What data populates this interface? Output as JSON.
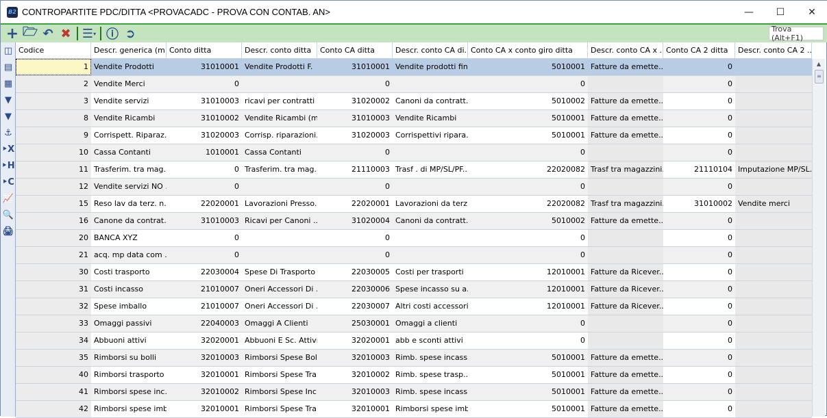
{
  "window": {
    "title": "CONTROPARTITE PDC/DITTA <PROVACADC - PROVA CON CONTAB. AN>",
    "app_icon": "B2"
  },
  "toolbar": {
    "find_label": "Trova (Alt+F1)"
  },
  "columns": [
    "Codice",
    "Descr. generica (m...",
    "Conto ditta",
    "Descr. conto ditta",
    "Conto CA ditta",
    "Descr. conto CA di...",
    "Conto CA x conto giro ditta",
    "Descr. conto CA x ...",
    "Conto CA 2 ditta",
    "Descr. conto CA 2 ..."
  ],
  "rows": [
    [
      "1",
      "Vendite Prodotti",
      "31010001",
      "Vendite Prodotti F.",
      "31010001",
      "Vendite prodotti finiti",
      "5010001",
      "Fatture da emette...",
      "0",
      ""
    ],
    [
      "2",
      "Vendite Merci",
      "0",
      "",
      "0",
      "",
      "0",
      "",
      "0",
      ""
    ],
    [
      "3",
      "Vendite servizi",
      "31010003",
      "ricavi per contratti ...",
      "31020002",
      "Canoni da contratt...",
      "5010002",
      "Fatture da emette...",
      "0",
      ""
    ],
    [
      "8",
      "Vendite Ricambi",
      "31010002",
      "Vendite Ricambi (m...",
      "31010003",
      "Vendite Ricambi",
      "5010001",
      "Fatture da emette...",
      "0",
      ""
    ],
    [
      "9",
      "Corrispett. Riparaz...",
      "31020003",
      "Corrisp. riparazioni...",
      "31020003",
      "Corrispettivi ripara...",
      "5010001",
      "Fatture da emette...",
      "0",
      ""
    ],
    [
      "10",
      "Cassa Contanti",
      "1010001",
      "Cassa Contanti",
      "0",
      "",
      "0",
      "",
      "0",
      ""
    ],
    [
      "11",
      "Trasferim. tra mag...",
      "0",
      "Trasferim. tra mag...",
      "21110003",
      "Trasf . di MP/SL/PF...",
      "22020082",
      "Trasf tra magazzini...",
      "21110104",
      "Imputazione MP/SL..."
    ],
    [
      "12",
      "Vendite servizi NO ...",
      "0",
      "",
      "0",
      "",
      "0",
      "",
      "0",
      ""
    ],
    [
      "15",
      "Reso lav da terz. n...",
      "22020001",
      "Lavorazioni Presso...",
      "22020001",
      "Lavorazioni da terz...",
      "22020082",
      "Trasf tra magazzini...",
      "31010002",
      "Vendite merci"
    ],
    [
      "16",
      "Canone da contrat...",
      "31010003",
      "Ricavi per Canoni  ...",
      "31020004",
      "Canoni da contratt...",
      "5010002",
      "Fatture da emette...",
      "0",
      ""
    ],
    [
      "20",
      "BANCA XYZ",
      "0",
      "",
      "0",
      "",
      "0",
      "",
      "0",
      ""
    ],
    [
      "21",
      "acq. mp data com ...",
      "0",
      "",
      "0",
      "",
      "0",
      "",
      "0",
      ""
    ],
    [
      "30",
      "Costi trasporto",
      "22030004",
      "Spese Di Trasporto",
      "22030005",
      "Costi per trasporti",
      "12010001",
      "Fatture da Ricever...",
      "0",
      ""
    ],
    [
      "31",
      "Costi incasso",
      "21010007",
      "Oneri Accessori Di ...",
      "22030006",
      "Spese incasso su a...",
      "12010001",
      "Fatture da Ricever...",
      "0",
      ""
    ],
    [
      "32",
      "Spese imballo",
      "21010007",
      "Oneri Accessori Di ...",
      "22030007",
      "Altri costi accessori...",
      "12010001",
      "Fatture da Ricever...",
      "0",
      ""
    ],
    [
      "33",
      "Omaggi passivi",
      "22040003",
      "Omaggi A Clienti",
      "25030001",
      "Omaggi a clienti",
      "0",
      "",
      "0",
      ""
    ],
    [
      "34",
      "Abbuoni attivi",
      "32020001",
      "Abbuoni E Sc. Attivi",
      "32020001",
      "abb e sconti attivi",
      "0",
      "",
      "0",
      ""
    ],
    [
      "35",
      "Rimborsi su bolli",
      "32010003",
      "Rimborsi Spese Bolli",
      "32010003",
      "Rimb. spese incass...",
      "5010001",
      "Fatture da emette...",
      "0",
      ""
    ],
    [
      "40",
      "Rimborsi trasporto",
      "32010001",
      "Rimborsi Spese Tra...",
      "32010002",
      "Rimb. spese trasp...",
      "5010001",
      "Fatture da emette...",
      "0",
      ""
    ],
    [
      "41",
      "Rimborsi spese inc...",
      "32010002",
      "Rimborsi Spese Inc...",
      "32010003",
      "Rimb. spese incass...",
      "5010001",
      "Fatture da emette...",
      "0",
      ""
    ],
    [
      "42",
      "Rimborsi spese imb...",
      "32010001",
      "Rimborsi Spese Tra...",
      "32010001",
      "Rimborsi spese imb...",
      "5010001",
      "Fatture da emette...",
      "0",
      ""
    ]
  ],
  "colors": {
    "toolbar_bg": "#c4e4c0",
    "selected_row": "#b8cce4",
    "current_cell": "#fdf7c6"
  }
}
